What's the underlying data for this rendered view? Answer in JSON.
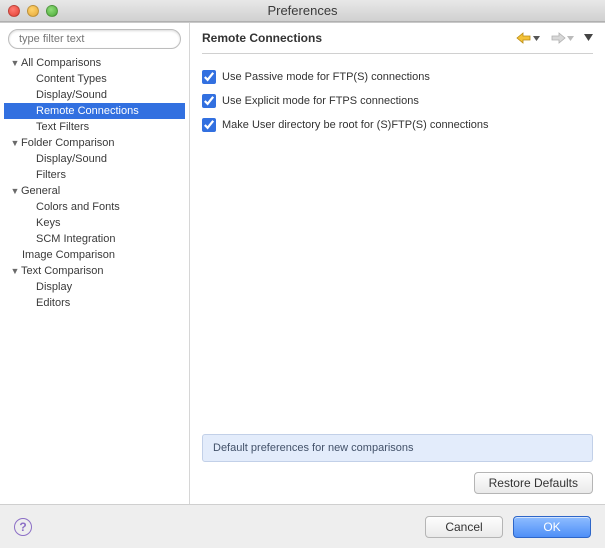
{
  "window": {
    "title": "Preferences"
  },
  "sidebar": {
    "filter_placeholder": "type filter text",
    "nodes": [
      {
        "label": "All Comparisons",
        "depth": 0,
        "expandable": true,
        "expanded": true
      },
      {
        "label": "Content Types",
        "depth": 1,
        "expandable": false
      },
      {
        "label": "Display/Sound",
        "depth": 1,
        "expandable": false
      },
      {
        "label": "Remote Connections",
        "depth": 1,
        "expandable": false,
        "selected": true
      },
      {
        "label": "Text Filters",
        "depth": 1,
        "expandable": false
      },
      {
        "label": "Folder Comparison",
        "depth": 0,
        "expandable": true,
        "expanded": true
      },
      {
        "label": "Display/Sound",
        "depth": 1,
        "expandable": false
      },
      {
        "label": "Filters",
        "depth": 1,
        "expandable": false
      },
      {
        "label": "General",
        "depth": 0,
        "expandable": true,
        "expanded": true
      },
      {
        "label": "Colors and Fonts",
        "depth": 1,
        "expandable": false
      },
      {
        "label": "Keys",
        "depth": 1,
        "expandable": false
      },
      {
        "label": "SCM Integration",
        "depth": 1,
        "expandable": false
      },
      {
        "label": "Image Comparison",
        "depth": 0,
        "expandable": false
      },
      {
        "label": "Text Comparison",
        "depth": 0,
        "expandable": true,
        "expanded": true
      },
      {
        "label": "Display",
        "depth": 1,
        "expandable": false
      },
      {
        "label": "Editors",
        "depth": 1,
        "expandable": false
      }
    ]
  },
  "main": {
    "heading": "Remote Connections",
    "options": [
      {
        "label": "Use Passive mode for FTP(S) connections",
        "checked": true
      },
      {
        "label": "Use Explicit mode for FTPS connections",
        "checked": true
      },
      {
        "label": "Make User directory be root for (S)FTP(S) connections",
        "checked": true
      }
    ],
    "info_banner": "Default preferences for new comparisons",
    "restore_defaults": "Restore Defaults"
  },
  "footer": {
    "cancel": "Cancel",
    "ok": "OK"
  },
  "colors": {
    "accent": "#3270e0"
  }
}
